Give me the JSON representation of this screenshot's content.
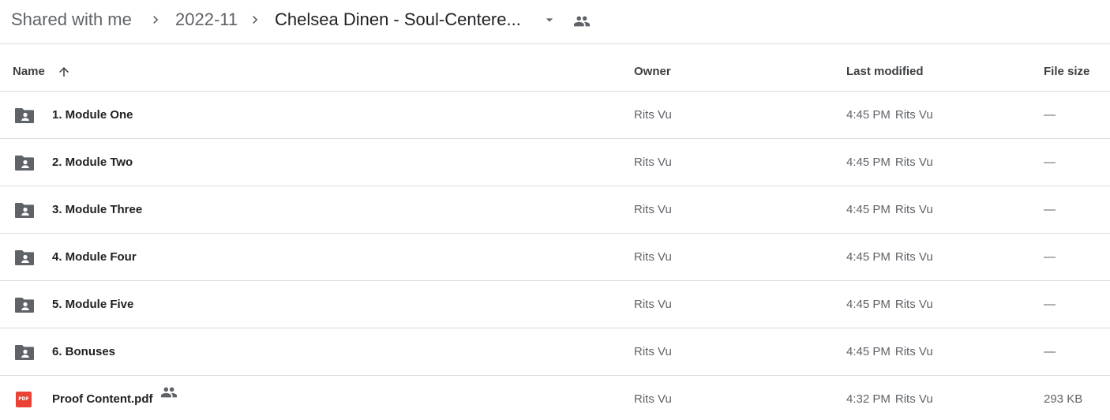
{
  "breadcrumb": {
    "items": [
      {
        "label": "Shared with me"
      },
      {
        "label": "2022-11"
      },
      {
        "label": "Chelsea Dinen - Soul-Centere..."
      }
    ]
  },
  "table": {
    "headers": {
      "name": "Name",
      "owner": "Owner",
      "last_modified": "Last modified",
      "file_size": "File size"
    },
    "sort_icon": "arrow-up-icon",
    "rows": [
      {
        "type": "shared-folder",
        "name": "1. Module One",
        "owner": "Rits Vu",
        "time": "4:45 PM",
        "modified_by": "Rits Vu",
        "size": "—"
      },
      {
        "type": "shared-folder",
        "name": "2. Module Two",
        "owner": "Rits Vu",
        "time": "4:45 PM",
        "modified_by": "Rits Vu",
        "size": "—"
      },
      {
        "type": "shared-folder",
        "name": "3. Module Three",
        "owner": "Rits Vu",
        "time": "4:45 PM",
        "modified_by": "Rits Vu",
        "size": "—"
      },
      {
        "type": "shared-folder",
        "name": "4. Module Four",
        "owner": "Rits Vu",
        "time": "4:45 PM",
        "modified_by": "Rits Vu",
        "size": "—"
      },
      {
        "type": "shared-folder",
        "name": "5. Module Five",
        "owner": "Rits Vu",
        "time": "4:45 PM",
        "modified_by": "Rits Vu",
        "size": "—"
      },
      {
        "type": "shared-folder",
        "name": "6. Bonuses",
        "owner": "Rits Vu",
        "time": "4:45 PM",
        "modified_by": "Rits Vu",
        "size": "—"
      },
      {
        "type": "pdf",
        "name": "Proof Content.pdf",
        "owner": "Rits Vu",
        "time": "4:32 PM",
        "modified_by": "Rits Vu",
        "size": "293 KB",
        "shared": true,
        "badge_text": "PDF"
      }
    ]
  },
  "colors": {
    "text_primary": "#202124",
    "text_secondary": "#5f6368",
    "divider": "#dadce0",
    "pdf_red": "#ea4335",
    "icon_gray": "#5f6368"
  }
}
